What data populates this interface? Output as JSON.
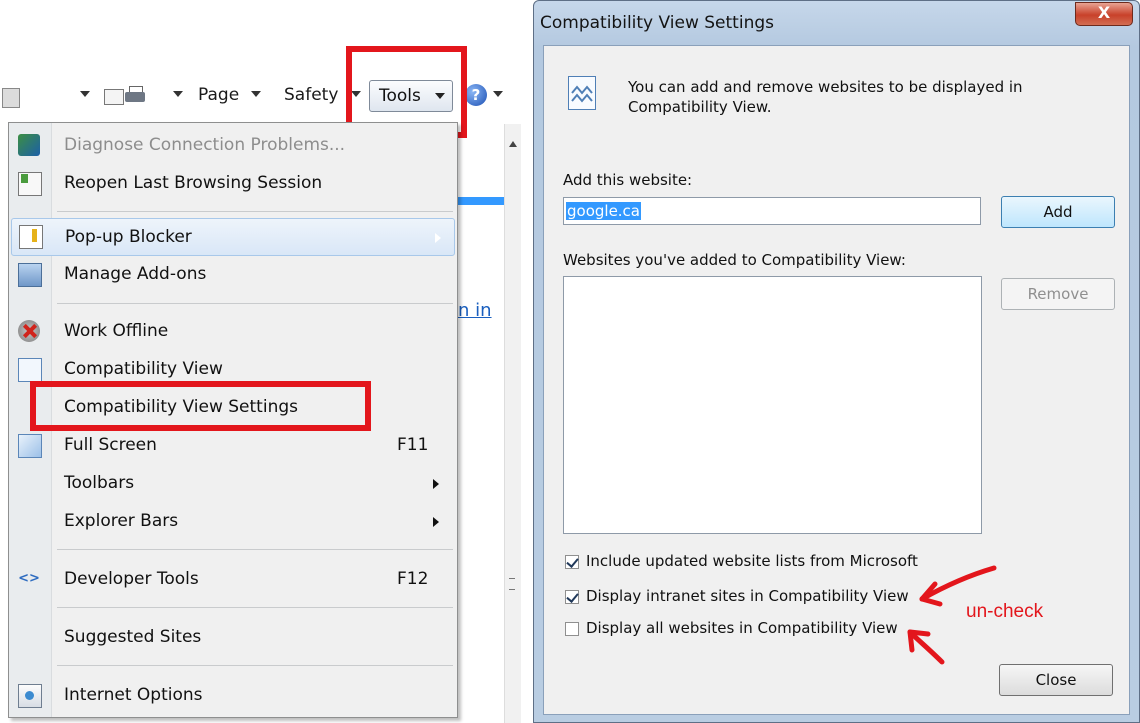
{
  "toolbar": {
    "page": "Page",
    "safety": "Safety",
    "tools": "Tools"
  },
  "menu": {
    "items": [
      {
        "label": "Diagnose Connection Problems...",
        "icon": "diagnose-icon",
        "disabled": true
      },
      {
        "label": "Reopen Last Browsing Session",
        "icon": "reopen-icon"
      },
      {
        "label": "Pop-up Blocker",
        "icon": "popup-blocker-icon"
      },
      {
        "label": "Manage Add-ons",
        "icon": "addons-icon"
      },
      {
        "label": "Work Offline",
        "icon": "work-offline-icon"
      },
      {
        "label": "Compatibility View",
        "icon": "compat-view-icon"
      },
      {
        "label": "Compatibility View Settings"
      },
      {
        "label": "Full Screen",
        "shortcut": "F11",
        "icon": "full-screen-icon"
      },
      {
        "label": "Toolbars"
      },
      {
        "label": "Explorer Bars"
      },
      {
        "label": "Developer Tools",
        "shortcut": "F12",
        "icon": "developer-tools-icon"
      },
      {
        "label": "Suggested Sites"
      },
      {
        "label": "Internet Options",
        "icon": "internet-options-icon"
      }
    ]
  },
  "behind_link": "n in",
  "dialog": {
    "title": "Compatibility View Settings",
    "close_glyph": "X",
    "intro_line1": "You can add and remove websites to be displayed in",
    "intro_line2": "Compatibility View.",
    "add_label": "Add this website:",
    "add_value": "google.ca",
    "add_button": "Add",
    "list_label": "Websites you've added to Compatibility View:",
    "remove_button": "Remove",
    "checks": [
      {
        "label": "Include updated website lists from Microsoft",
        "checked": true
      },
      {
        "label": "Display intranet sites in Compatibility View",
        "checked": true
      },
      {
        "label": "Display all websites in Compatibility View",
        "checked": false
      }
    ],
    "close_button": "Close"
  },
  "annotation": "un-check",
  "colors": {
    "highlight": "#e3161c",
    "dialog_frame": "#b9cde2"
  }
}
